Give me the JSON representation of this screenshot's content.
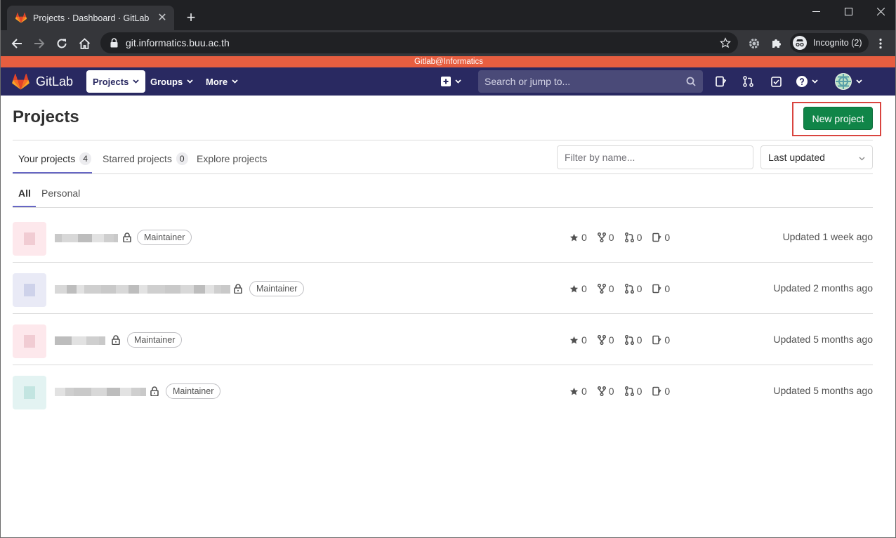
{
  "browser": {
    "tab_title": "Projects · Dashboard · GitLab",
    "url": "git.informatics.buu.ac.th",
    "incognito_label": "Incognito (2)"
  },
  "gitlab": {
    "banner": "Gitlab@Informatics",
    "brand": "GitLab",
    "nav": {
      "projects": "Projects",
      "groups": "Groups",
      "more": "More"
    },
    "search_placeholder": "Search or jump to..."
  },
  "page": {
    "title": "Projects",
    "new_project": "New project",
    "tabs": [
      {
        "label": "Your projects",
        "count": "4"
      },
      {
        "label": "Starred projects",
        "count": "0"
      },
      {
        "label": "Explore projects"
      }
    ],
    "filter_placeholder": "Filter by name...",
    "sort_value": "Last updated",
    "subtabs": [
      "All",
      "Personal"
    ]
  },
  "projects": [
    {
      "role": "Maintainer",
      "stars": "0",
      "forks": "0",
      "merge_requests": "0",
      "issues": "0",
      "updated": "Updated 1 week ago",
      "avatar_color": "#fde8ec"
    },
    {
      "role": "Maintainer",
      "stars": "0",
      "forks": "0",
      "merge_requests": "0",
      "issues": "0",
      "updated": "Updated 2 months ago",
      "avatar_color": "#e9eaf6"
    },
    {
      "role": "Maintainer",
      "stars": "0",
      "forks": "0",
      "merge_requests": "0",
      "issues": "0",
      "updated": "Updated 5 months ago",
      "avatar_color": "#fde8ec"
    },
    {
      "role": "Maintainer",
      "stars": "0",
      "forks": "0",
      "merge_requests": "0",
      "issues": "0",
      "updated": "Updated 5 months ago",
      "avatar_color": "#e3f3f2"
    }
  ]
}
